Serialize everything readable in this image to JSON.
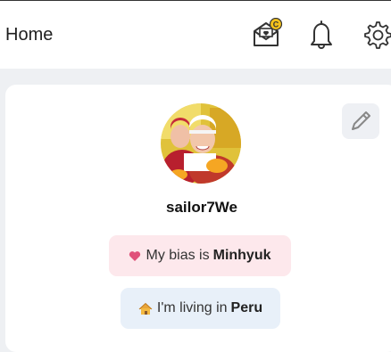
{
  "header": {
    "title": "Home",
    "icons": [
      "mail-coin-icon",
      "bell-icon",
      "gear-icon"
    ],
    "coin_badge": "C"
  },
  "profile": {
    "username": "sailor7We",
    "bias_prefix": "My bias is",
    "bias_name": "Minhyuk",
    "living_prefix": "I'm living in",
    "living_place": "Peru"
  },
  "colors": {
    "bias_pill_bg": "#fde8ec",
    "living_pill_bg": "#e8f0f9",
    "heart": "#e0517a",
    "coin_badge": "#f4c21c"
  }
}
